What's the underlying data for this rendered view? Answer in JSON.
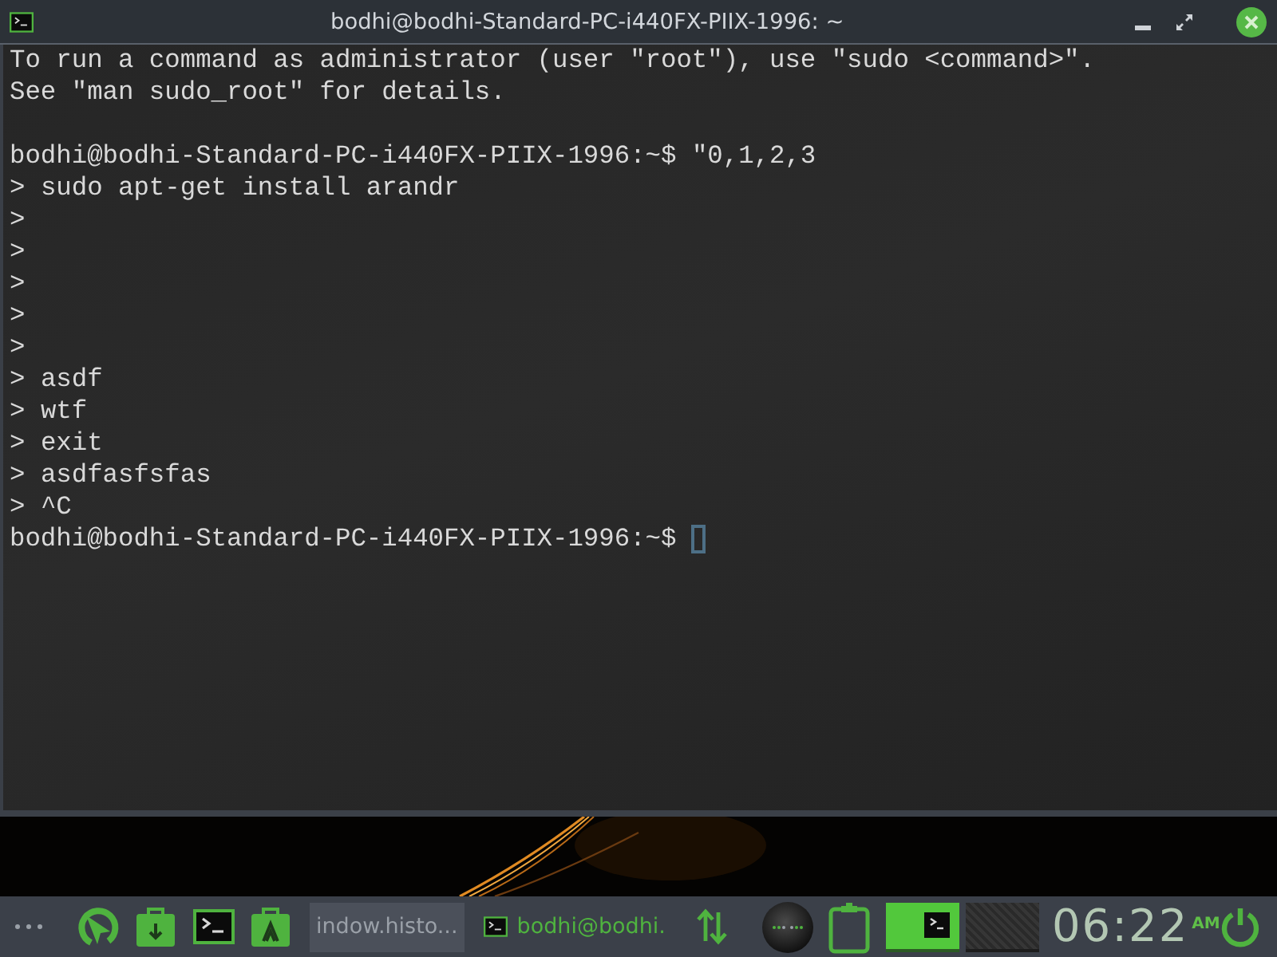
{
  "window": {
    "title": "bodhi@bodhi-Standard-PC-i440FX-PIIX-1996: ~"
  },
  "terminal": {
    "lines": [
      {
        "kind": "output",
        "text": "To run a command as administrator (user \"root\"), use \"sudo <command>\"."
      },
      {
        "kind": "output",
        "text": "See \"man sudo_root\" for details."
      },
      {
        "kind": "blank"
      },
      {
        "kind": "prompt",
        "prompt": "bodhi@bodhi-Standard-PC-i440FX-PIIX-1996:~$",
        "text": "\"0,1,2,3"
      },
      {
        "kind": "continuation",
        "marker": ">",
        "text": "sudo apt-get install arandr"
      },
      {
        "kind": "continuation",
        "marker": ">"
      },
      {
        "kind": "continuation",
        "marker": ">"
      },
      {
        "kind": "continuation",
        "marker": ">"
      },
      {
        "kind": "continuation",
        "marker": ">"
      },
      {
        "kind": "continuation",
        "marker": ">"
      },
      {
        "kind": "continuation",
        "marker": ">",
        "text": "asdf"
      },
      {
        "kind": "continuation",
        "marker": ">",
        "text": "wtf"
      },
      {
        "kind": "continuation",
        "marker": ">",
        "text": "exit"
      },
      {
        "kind": "continuation",
        "marker": ">",
        "text": "asdfasfsfas"
      },
      {
        "kind": "continuation",
        "marker": ">",
        "text": "^C"
      },
      {
        "kind": "prompt",
        "prompt": "bodhi@bodhi-Standard-PC-i440FX-PIIX-1996:~$",
        "cursor": true
      }
    ]
  },
  "taskbar": {
    "tasks": [
      {
        "kind": "plain",
        "label": "indow.histo...",
        "selected": true
      },
      {
        "kind": "terminal",
        "label": "bodhi@bodhi.",
        "selected": false
      }
    ],
    "workspaces": [
      {
        "selected": true,
        "occupied": true
      },
      {
        "selected": false,
        "occupied": false
      }
    ],
    "clock": {
      "time": "06:22",
      "period": "AM"
    }
  }
}
